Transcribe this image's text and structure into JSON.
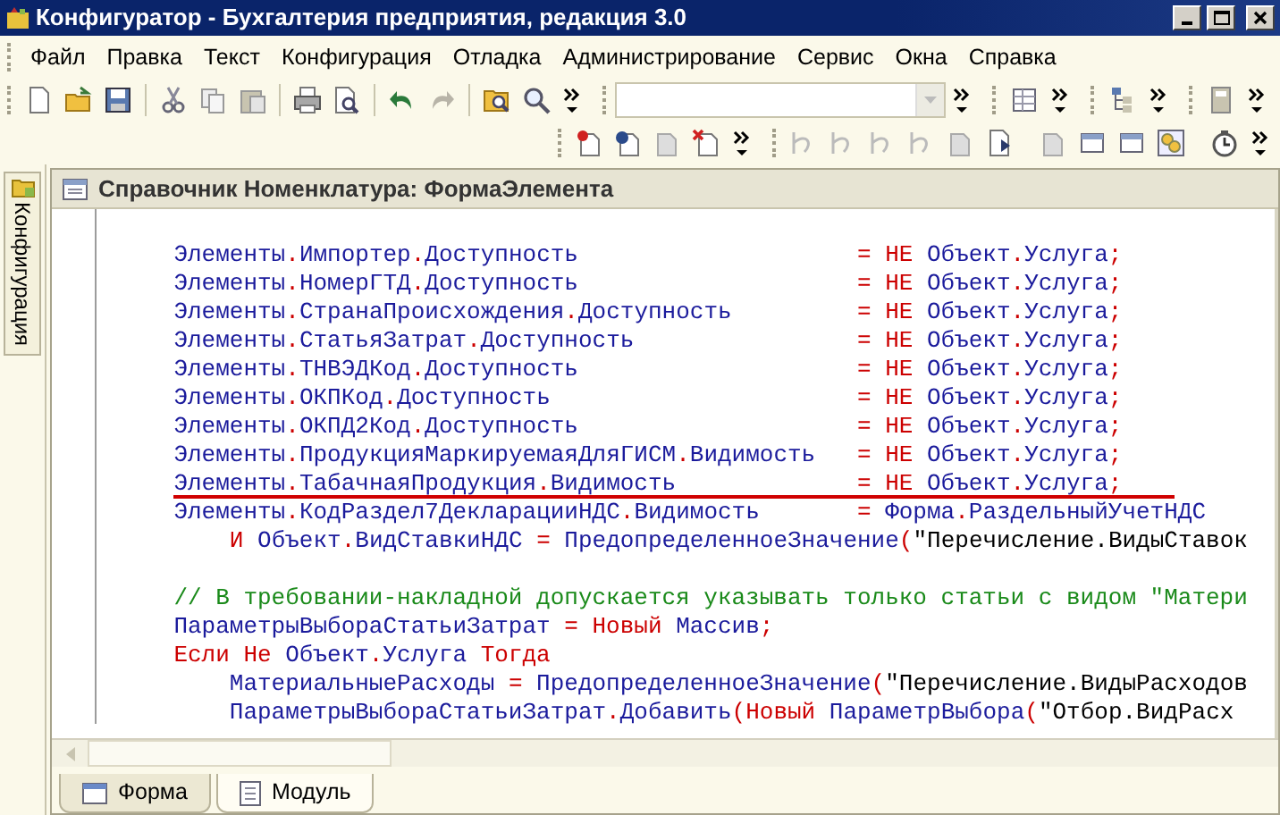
{
  "window": {
    "title": "Конфигуратор - Бухгалтерия предприятия, редакция 3.0"
  },
  "menu": [
    "Файл",
    "Правка",
    "Текст",
    "Конфигурация",
    "Отладка",
    "Администрирование",
    "Сервис",
    "Окна",
    "Справка"
  ],
  "side_panel": {
    "tab_label": "Конфигурация"
  },
  "editor": {
    "title": "Справочник Номенклатура: ФормаЭлемента",
    "lines": [
      {
        "indented": false,
        "underlined": false,
        "code": [
          {
            "kind": "id",
            "text": "Элементы"
          },
          {
            "kind": "op",
            "text": "."
          },
          {
            "kind": "id",
            "text": "Импортер"
          },
          {
            "kind": "op",
            "text": "."
          },
          {
            "kind": "id",
            "text": "Доступность"
          }
        ],
        "value": [
          {
            "kind": "op",
            "text": "="
          },
          {
            "kind": "kw",
            "text": " НЕ"
          },
          {
            "kind": "id",
            "text": " Объект"
          },
          {
            "kind": "op",
            "text": "."
          },
          {
            "kind": "id",
            "text": "Услуга"
          },
          {
            "kind": "op",
            "text": ";"
          }
        ]
      },
      {
        "indented": false,
        "underlined": false,
        "code": [
          {
            "kind": "id",
            "text": "Элементы"
          },
          {
            "kind": "op",
            "text": "."
          },
          {
            "kind": "id",
            "text": "НомерГТД"
          },
          {
            "kind": "op",
            "text": "."
          },
          {
            "kind": "id",
            "text": "Доступность"
          }
        ],
        "value": [
          {
            "kind": "op",
            "text": "="
          },
          {
            "kind": "kw",
            "text": " НЕ"
          },
          {
            "kind": "id",
            "text": " Объект"
          },
          {
            "kind": "op",
            "text": "."
          },
          {
            "kind": "id",
            "text": "Услуга"
          },
          {
            "kind": "op",
            "text": ";"
          }
        ]
      },
      {
        "indented": false,
        "underlined": false,
        "code": [
          {
            "kind": "id",
            "text": "Элементы"
          },
          {
            "kind": "op",
            "text": "."
          },
          {
            "kind": "id",
            "text": "СтранаПроисхождения"
          },
          {
            "kind": "op",
            "text": "."
          },
          {
            "kind": "id",
            "text": "Доступность"
          }
        ],
        "value": [
          {
            "kind": "op",
            "text": "="
          },
          {
            "kind": "kw",
            "text": " НЕ"
          },
          {
            "kind": "id",
            "text": " Объект"
          },
          {
            "kind": "op",
            "text": "."
          },
          {
            "kind": "id",
            "text": "Услуга"
          },
          {
            "kind": "op",
            "text": ";"
          }
        ]
      },
      {
        "indented": false,
        "underlined": false,
        "code": [
          {
            "kind": "id",
            "text": "Элементы"
          },
          {
            "kind": "op",
            "text": "."
          },
          {
            "kind": "id",
            "text": "СтатьяЗатрат"
          },
          {
            "kind": "op",
            "text": "."
          },
          {
            "kind": "id",
            "text": "Доступность"
          }
        ],
        "value": [
          {
            "kind": "op",
            "text": "="
          },
          {
            "kind": "kw",
            "text": " НЕ"
          },
          {
            "kind": "id",
            "text": " Объект"
          },
          {
            "kind": "op",
            "text": "."
          },
          {
            "kind": "id",
            "text": "Услуга"
          },
          {
            "kind": "op",
            "text": ";"
          }
        ]
      },
      {
        "indented": false,
        "underlined": false,
        "code": [
          {
            "kind": "id",
            "text": "Элементы"
          },
          {
            "kind": "op",
            "text": "."
          },
          {
            "kind": "id",
            "text": "ТНВЭДКод"
          },
          {
            "kind": "op",
            "text": "."
          },
          {
            "kind": "id",
            "text": "Доступность"
          }
        ],
        "value": [
          {
            "kind": "op",
            "text": "="
          },
          {
            "kind": "kw",
            "text": " НЕ"
          },
          {
            "kind": "id",
            "text": " Объект"
          },
          {
            "kind": "op",
            "text": "."
          },
          {
            "kind": "id",
            "text": "Услуга"
          },
          {
            "kind": "op",
            "text": ";"
          }
        ]
      },
      {
        "indented": false,
        "underlined": false,
        "code": [
          {
            "kind": "id",
            "text": "Элементы"
          },
          {
            "kind": "op",
            "text": "."
          },
          {
            "kind": "id",
            "text": "ОКПКод"
          },
          {
            "kind": "op",
            "text": "."
          },
          {
            "kind": "id",
            "text": "Доступность"
          }
        ],
        "value": [
          {
            "kind": "op",
            "text": "="
          },
          {
            "kind": "kw",
            "text": " НЕ"
          },
          {
            "kind": "id",
            "text": " Объект"
          },
          {
            "kind": "op",
            "text": "."
          },
          {
            "kind": "id",
            "text": "Услуга"
          },
          {
            "kind": "op",
            "text": ";"
          }
        ]
      },
      {
        "indented": false,
        "underlined": false,
        "code": [
          {
            "kind": "id",
            "text": "Элементы"
          },
          {
            "kind": "op",
            "text": "."
          },
          {
            "kind": "id",
            "text": "ОКПД2Код"
          },
          {
            "kind": "op",
            "text": "."
          },
          {
            "kind": "id",
            "text": "Доступность"
          }
        ],
        "value": [
          {
            "kind": "op",
            "text": "="
          },
          {
            "kind": "kw",
            "text": " НЕ"
          },
          {
            "kind": "id",
            "text": " Объект"
          },
          {
            "kind": "op",
            "text": "."
          },
          {
            "kind": "id",
            "text": "Услуга"
          },
          {
            "kind": "op",
            "text": ";"
          }
        ]
      },
      {
        "indented": false,
        "underlined": false,
        "code": [
          {
            "kind": "id",
            "text": "Элементы"
          },
          {
            "kind": "op",
            "text": "."
          },
          {
            "kind": "id",
            "text": "ПродукцияМаркируемаяДляГИСМ"
          },
          {
            "kind": "op",
            "text": "."
          },
          {
            "kind": "id",
            "text": "Видимость"
          }
        ],
        "value": [
          {
            "kind": "op",
            "text": "="
          },
          {
            "kind": "kw",
            "text": " НЕ"
          },
          {
            "kind": "id",
            "text": " Объект"
          },
          {
            "kind": "op",
            "text": "."
          },
          {
            "kind": "id",
            "text": "Услуга"
          },
          {
            "kind": "op",
            "text": ";"
          }
        ]
      },
      {
        "indented": false,
        "underlined": true,
        "code": [
          {
            "kind": "id",
            "text": "Элементы"
          },
          {
            "kind": "op",
            "text": "."
          },
          {
            "kind": "id",
            "text": "ТабачнаяПродукция"
          },
          {
            "kind": "op",
            "text": "."
          },
          {
            "kind": "id",
            "text": "Видимость"
          }
        ],
        "value": [
          {
            "kind": "op",
            "text": "="
          },
          {
            "kind": "kw",
            "text": " НЕ"
          },
          {
            "kind": "id",
            "text": " Объект"
          },
          {
            "kind": "op",
            "text": "."
          },
          {
            "kind": "id",
            "text": "Услуга"
          },
          {
            "kind": "op",
            "text": ";"
          }
        ]
      },
      {
        "indented": false,
        "underlined": false,
        "code": [
          {
            "kind": "id",
            "text": "Элементы"
          },
          {
            "kind": "op",
            "text": "."
          },
          {
            "kind": "id",
            "text": "КодРаздел7ДекларацииНДС"
          },
          {
            "kind": "op",
            "text": "."
          },
          {
            "kind": "id",
            "text": "Видимость"
          }
        ],
        "value": [
          {
            "kind": "op",
            "text": "="
          },
          {
            "kind": "id",
            "text": " Форма"
          },
          {
            "kind": "op",
            "text": "."
          },
          {
            "kind": "id",
            "text": "РаздельныйУчетНДС"
          }
        ]
      },
      {
        "indented": true,
        "underlined": false,
        "code": [
          {
            "kind": "kw",
            "text": "И"
          },
          {
            "kind": "id",
            "text": " Объект"
          },
          {
            "kind": "op",
            "text": "."
          },
          {
            "kind": "id",
            "text": "ВидСтавкиНДС "
          },
          {
            "kind": "op",
            "text": "="
          },
          {
            "kind": "id",
            "text": " ПредопределенноеЗначение"
          },
          {
            "kind": "op",
            "text": "("
          },
          {
            "kind": "str",
            "text": "\"Перечисление.ВидыСтавок"
          }
        ]
      },
      {
        "indented": false,
        "underlined": false
      },
      {
        "indented": false,
        "underlined": false,
        "code": [
          {
            "kind": "comment",
            "text": "// В требовании-накладной допускается указывать только статьи с видом \"Матери"
          }
        ]
      },
      {
        "indented": false,
        "underlined": false,
        "code": [
          {
            "kind": "id",
            "text": "ПараметрыВыбораСтатьиЗатрат "
          },
          {
            "kind": "op",
            "text": "= "
          },
          {
            "kind": "kw",
            "text": "Новый"
          },
          {
            "kind": "id",
            "text": " Массив"
          },
          {
            "kind": "op",
            "text": ";"
          }
        ]
      },
      {
        "indented": false,
        "underlined": false,
        "code": [
          {
            "kind": "kw",
            "text": "Если Не"
          },
          {
            "kind": "id",
            "text": " Объект"
          },
          {
            "kind": "op",
            "text": "."
          },
          {
            "kind": "id",
            "text": "Услуга"
          },
          {
            "kind": "kw",
            "text": " Тогда"
          }
        ]
      },
      {
        "indented": true,
        "underlined": false,
        "code": [
          {
            "kind": "id",
            "text": "МатериальныеРасходы "
          },
          {
            "kind": "op",
            "text": "="
          },
          {
            "kind": "id",
            "text": " ПредопределенноеЗначение"
          },
          {
            "kind": "op",
            "text": "("
          },
          {
            "kind": "str",
            "text": "\"Перечисление.ВидыРасходов"
          }
        ]
      },
      {
        "indented": true,
        "underlined": false,
        "code": [
          {
            "kind": "id",
            "text": "ПараметрыВыбораСтатьиЗатрат"
          },
          {
            "kind": "op",
            "text": "."
          },
          {
            "kind": "id",
            "text": "Добавить"
          },
          {
            "kind": "op",
            "text": "("
          },
          {
            "kind": "kw",
            "text": "Новый"
          },
          {
            "kind": "id",
            "text": " ПараметрВыбора"
          },
          {
            "kind": "op",
            "text": "("
          },
          {
            "kind": "str",
            "text": "\"Отбор.ВидРасх"
          }
        ]
      }
    ]
  },
  "bottom_tabs": [
    {
      "label": "Форма",
      "selected": true
    },
    {
      "label": "Модуль",
      "selected": false
    }
  ]
}
